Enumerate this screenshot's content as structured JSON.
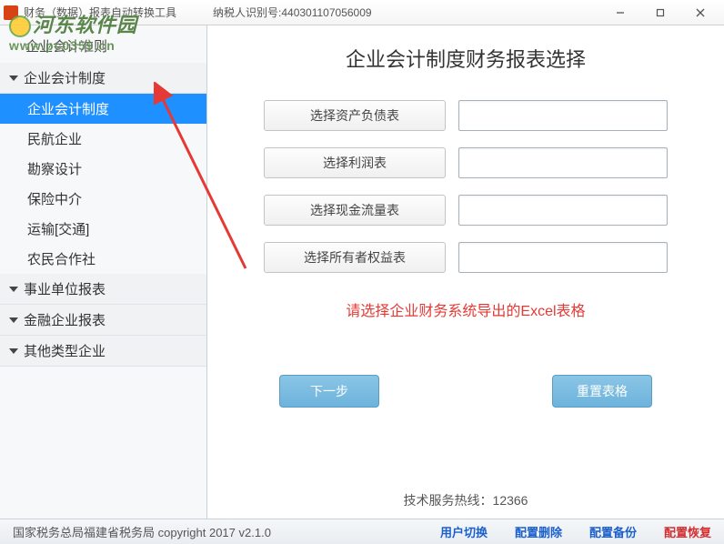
{
  "window": {
    "title": "财务（数据）报表自动转换工具",
    "taxid_label": "纳税人识别号:",
    "taxid_value": "440301107056009"
  },
  "watermark": {
    "line1": "河东软件园",
    "line2": "www.pc0359.cn"
  },
  "sidebar": {
    "header": "企业会计准则",
    "categories": [
      {
        "label": "企业会计制度",
        "expanded": true,
        "items": [
          "企业会计制度",
          "民航企业",
          "勘察设计",
          "保险中介",
          "运输[交通]",
          "农民合作社"
        ],
        "selected_index": 0
      },
      {
        "label": "事业单位报表",
        "expanded": false
      },
      {
        "label": "金融企业报表",
        "expanded": false
      },
      {
        "label": "其他类型企业",
        "expanded": false
      }
    ]
  },
  "main": {
    "title": "企业会计制度财务报表选择",
    "buttons": [
      "选择资产负债表",
      "选择利润表",
      "选择现金流量表",
      "选择所有者权益表"
    ],
    "inputs": [
      "",
      "",
      "",
      ""
    ],
    "hint": "请选择企业财务系统导出的Excel表格",
    "next_label": "下一步",
    "reset_label": "重置表格",
    "hotline_label": "技术服务热线：",
    "hotline_number": "12366"
  },
  "footer": {
    "copyright": "国家税务总局福建省税务局  copyright 2017  v2.1.0",
    "links": [
      {
        "text": "用户切换",
        "color": "blue"
      },
      {
        "text": "配置删除",
        "color": "blue"
      },
      {
        "text": "配置备份",
        "color": "blue"
      },
      {
        "text": "配置恢复",
        "color": "red"
      }
    ]
  }
}
